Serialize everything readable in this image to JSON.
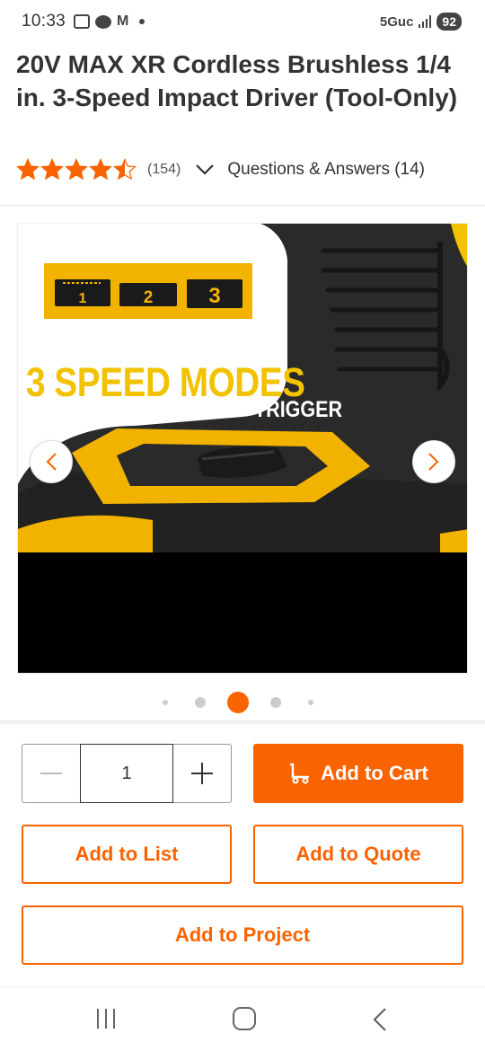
{
  "status_bar": {
    "time": "10:33",
    "network": "5Guc",
    "battery": "92"
  },
  "product": {
    "title": "20V MAX XR Cordless Brushless 1/4 in. 3-Speed Impact Driver (Tool-Only)",
    "rating": 4.5,
    "review_count": "(154)",
    "qa_label": "Questions & Answers (14)",
    "image_text": {
      "mode_labels": [
        "1",
        "2",
        "3"
      ],
      "headline": "3 SPEED MODES",
      "subheadline": "WITH VARIABLE SPEED TRIGGER"
    },
    "carousel": {
      "total": 5,
      "active_index": 2
    }
  },
  "purchase": {
    "quantity": "1",
    "add_to_cart": "Add to Cart",
    "add_to_list": "Add to List",
    "add_to_quote": "Add to Quote",
    "add_to_project": "Add to Project"
  },
  "colors": {
    "brand_orange": "#f96302",
    "dewalt_yellow": "#f2c200",
    "text_dark": "#333333"
  },
  "icons": {
    "star": "star-icon",
    "chevron": "chevron-down-icon",
    "cart": "cart-dolly-icon"
  }
}
